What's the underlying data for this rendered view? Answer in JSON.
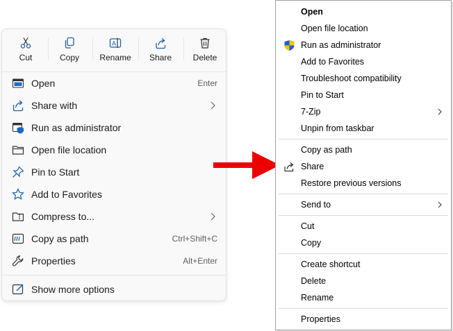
{
  "modern_menu": {
    "toolbar": [
      {
        "label": "Cut",
        "icon": "cut-icon"
      },
      {
        "label": "Copy",
        "icon": "copy-icon"
      },
      {
        "label": "Rename",
        "icon": "rename-icon"
      },
      {
        "label": "Share",
        "icon": "share-icon"
      },
      {
        "label": "Delete",
        "icon": "delete-icon"
      }
    ],
    "items": [
      {
        "label": "Open",
        "shortcut": "Enter",
        "icon": "open-app-icon"
      },
      {
        "label": "Share with",
        "submenu": true,
        "icon": "share-with-icon"
      },
      {
        "label": "Run as administrator",
        "icon": "shield-icon"
      },
      {
        "label": "Open file location",
        "icon": "folder-icon"
      },
      {
        "label": "Pin to Start",
        "icon": "pin-icon"
      },
      {
        "label": "Add to Favorites",
        "icon": "star-icon"
      },
      {
        "label": "Compress to...",
        "submenu": true,
        "icon": "zip-folder-icon"
      },
      {
        "label": "Copy as path",
        "shortcut": "Ctrl+Shift+C",
        "icon": "copy-path-icon"
      },
      {
        "label": "Properties",
        "shortcut": "Alt+Enter",
        "icon": "wrench-icon"
      },
      {
        "label": "Show more options",
        "icon": "external-icon"
      }
    ]
  },
  "classic_menu": {
    "items": [
      {
        "label": "Open",
        "bold": true
      },
      {
        "label": "Open file location"
      },
      {
        "label": "Run as administrator",
        "icon": "uac-shield-icon"
      },
      {
        "label": "Add to Favorites"
      },
      {
        "label": "Troubleshoot compatibility"
      },
      {
        "label": "Pin to Start"
      },
      {
        "label": "7-Zip",
        "submenu": true
      },
      {
        "label": "Unpin from taskbar"
      },
      {
        "label": "Copy as path"
      },
      {
        "label": "Share",
        "icon": "share-icon"
      },
      {
        "label": "Restore previous versions"
      },
      {
        "label": "Send to",
        "submenu": true
      },
      {
        "label": "Cut"
      },
      {
        "label": "Copy"
      },
      {
        "label": "Create shortcut"
      },
      {
        "label": "Delete"
      },
      {
        "label": "Rename"
      },
      {
        "label": "Properties"
      }
    ]
  },
  "colors": {
    "arrow": "#ee0000",
    "accent": "#0067c0",
    "uac_blue": "#1a64c8",
    "uac_yellow": "#f5c400"
  }
}
